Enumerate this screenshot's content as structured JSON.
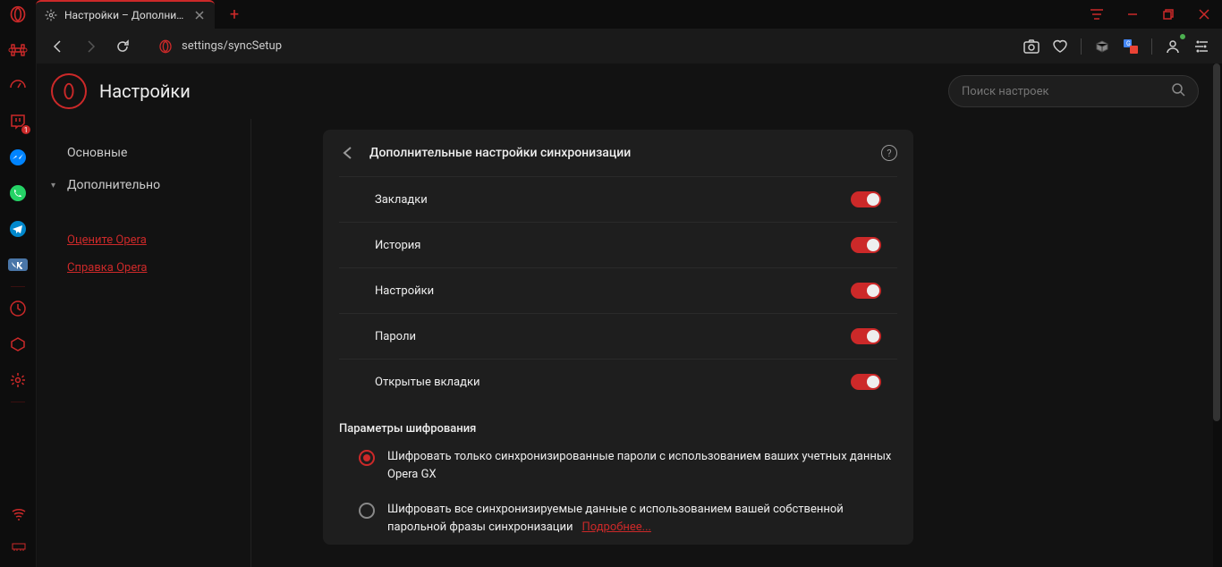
{
  "tab": {
    "title": "Настройки – Дополнительно"
  },
  "address": "settings/syncSetup",
  "sidebar_badge": "1",
  "settings": {
    "title": "Настройки",
    "search_placeholder": "Поиск настроек",
    "nav": {
      "basic": "Основные",
      "advanced": "Дополнительно",
      "rate": "Оцените Opera",
      "help": "Справка Opera"
    },
    "panel": {
      "title": "Дополнительные настройки синхронизации",
      "toggles": [
        {
          "label": "Закладки"
        },
        {
          "label": "История"
        },
        {
          "label": "Настройки"
        },
        {
          "label": "Пароли"
        },
        {
          "label": "Открытые вкладки"
        }
      ],
      "encryption_title": "Параметры шифрования",
      "radio1": "Шифровать только синхронизированные пароли с использованием ваших учетных данных Opera GX",
      "radio2": "Шифровать все синхронизируемые данные с использованием вашей собственной парольной фразы синхронизации",
      "radio2_link": "Подробнее..."
    }
  }
}
